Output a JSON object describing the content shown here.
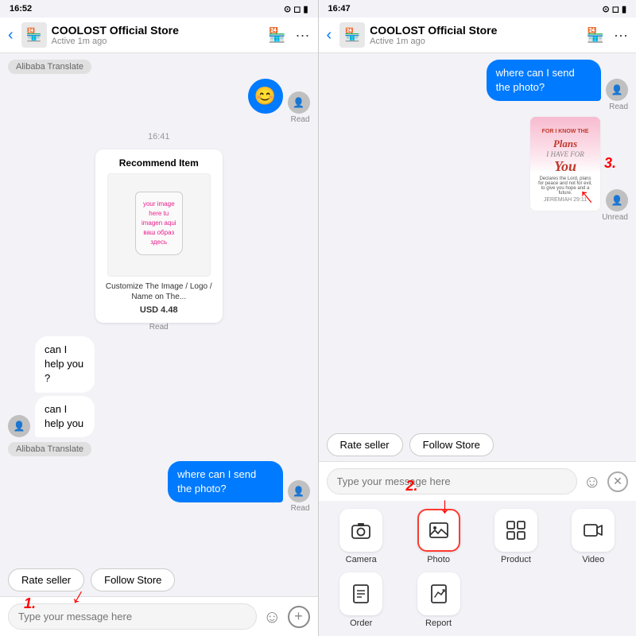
{
  "left_panel": {
    "status_bar": {
      "time": "16:52",
      "icons": "⊙ ▮"
    },
    "header": {
      "back": "‹",
      "store_name": "COOLOST Official Store",
      "active_status": "Active 1m ago",
      "store_icon": "🏪",
      "more_icon": "···"
    },
    "chat": {
      "translate_badge": "Alibaba Translate",
      "emoji": "😊",
      "read_label": "Read",
      "timestamp": "16:41",
      "recommend": {
        "title": "Recommend Item",
        "desc": "Customize The Image / Logo / Name on The...",
        "price": "USD 4.48",
        "read": "Read",
        "img_text": "your image here\ntu imagen aqui\nваш образ\nздесь"
      },
      "messages_left": [
        "can I help you ?",
        "can I help you"
      ],
      "translate_badge2": "Alibaba Translate",
      "user_msg": "where can I send the photo?",
      "read2": "Read"
    },
    "quick_actions": {
      "rate_seller": "Rate seller",
      "follow_store": "Follow Store"
    },
    "input": {
      "placeholder": "Type your message here",
      "emoji_icon": "☺",
      "plus_icon": "⊕"
    },
    "annotation1": "1."
  },
  "right_panel": {
    "status_bar": {
      "time": "16:47",
      "icons": "⊙ ▮"
    },
    "header": {
      "back": "‹",
      "store_name": "COOLOST Official Store",
      "active_status": "Active 1m ago",
      "store_icon": "🏪",
      "more_icon": "···"
    },
    "chat": {
      "user_msg": "where can I send the photo?",
      "read_label": "Read",
      "unread_label": "Unread"
    },
    "quick_actions": {
      "rate_seller": "Rate seller",
      "follow_store": "Follow Store"
    },
    "input": {
      "placeholder": "Type your message here",
      "emoji_icon": "☺",
      "x_icon": "⊗"
    },
    "media_grid": {
      "items": [
        {
          "icon": "📷",
          "label": "Camera"
        },
        {
          "icon": "🖼",
          "label": "Photo",
          "highlighted": true
        },
        {
          "icon": "⊞",
          "label": "Product"
        },
        {
          "icon": "🎬",
          "label": "Video"
        },
        {
          "icon": "📋",
          "label": "Order"
        },
        {
          "icon": "🚩",
          "label": "Report"
        }
      ]
    },
    "annotation2": "2.",
    "annotation3": "3."
  }
}
